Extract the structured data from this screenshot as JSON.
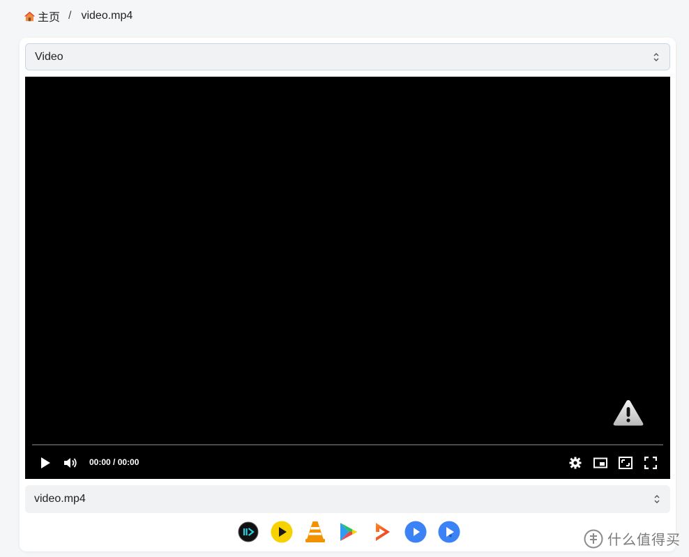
{
  "breadcrumb": {
    "home_label": "主页",
    "separator": "/",
    "current": "video.mp4"
  },
  "source_select": {
    "value": "Video"
  },
  "player": {
    "time_display": "00:00 / 00:00",
    "progress": 0,
    "state": "error",
    "icons": [
      "play-icon",
      "volume-icon",
      "settings-icon",
      "pip-icon",
      "resize-icon",
      "fullscreen-icon",
      "warning-icon"
    ]
  },
  "file_select": {
    "value": "video.mp4"
  },
  "external_players": [
    {
      "name": "iina",
      "icon": "iina-icon",
      "color": "#111111"
    },
    {
      "name": "potplayer",
      "icon": "potplayer-icon",
      "color": "#f7d100"
    },
    {
      "name": "vlc",
      "icon": "vlc-icon",
      "color": "#f39200"
    },
    {
      "name": "mx-player",
      "icon": "mxplayer-icon",
      "color": "#2f9cf3"
    },
    {
      "name": "infuse",
      "icon": "infuse-icon",
      "color": "#ff5a1f"
    },
    {
      "name": "nplayer",
      "icon": "nplayer-icon",
      "color": "#3b82f6"
    },
    {
      "name": "omniplayer",
      "icon": "omniplayer-icon",
      "color": "#3b82f6"
    }
  ],
  "watermark": {
    "text": "什么值得买"
  }
}
